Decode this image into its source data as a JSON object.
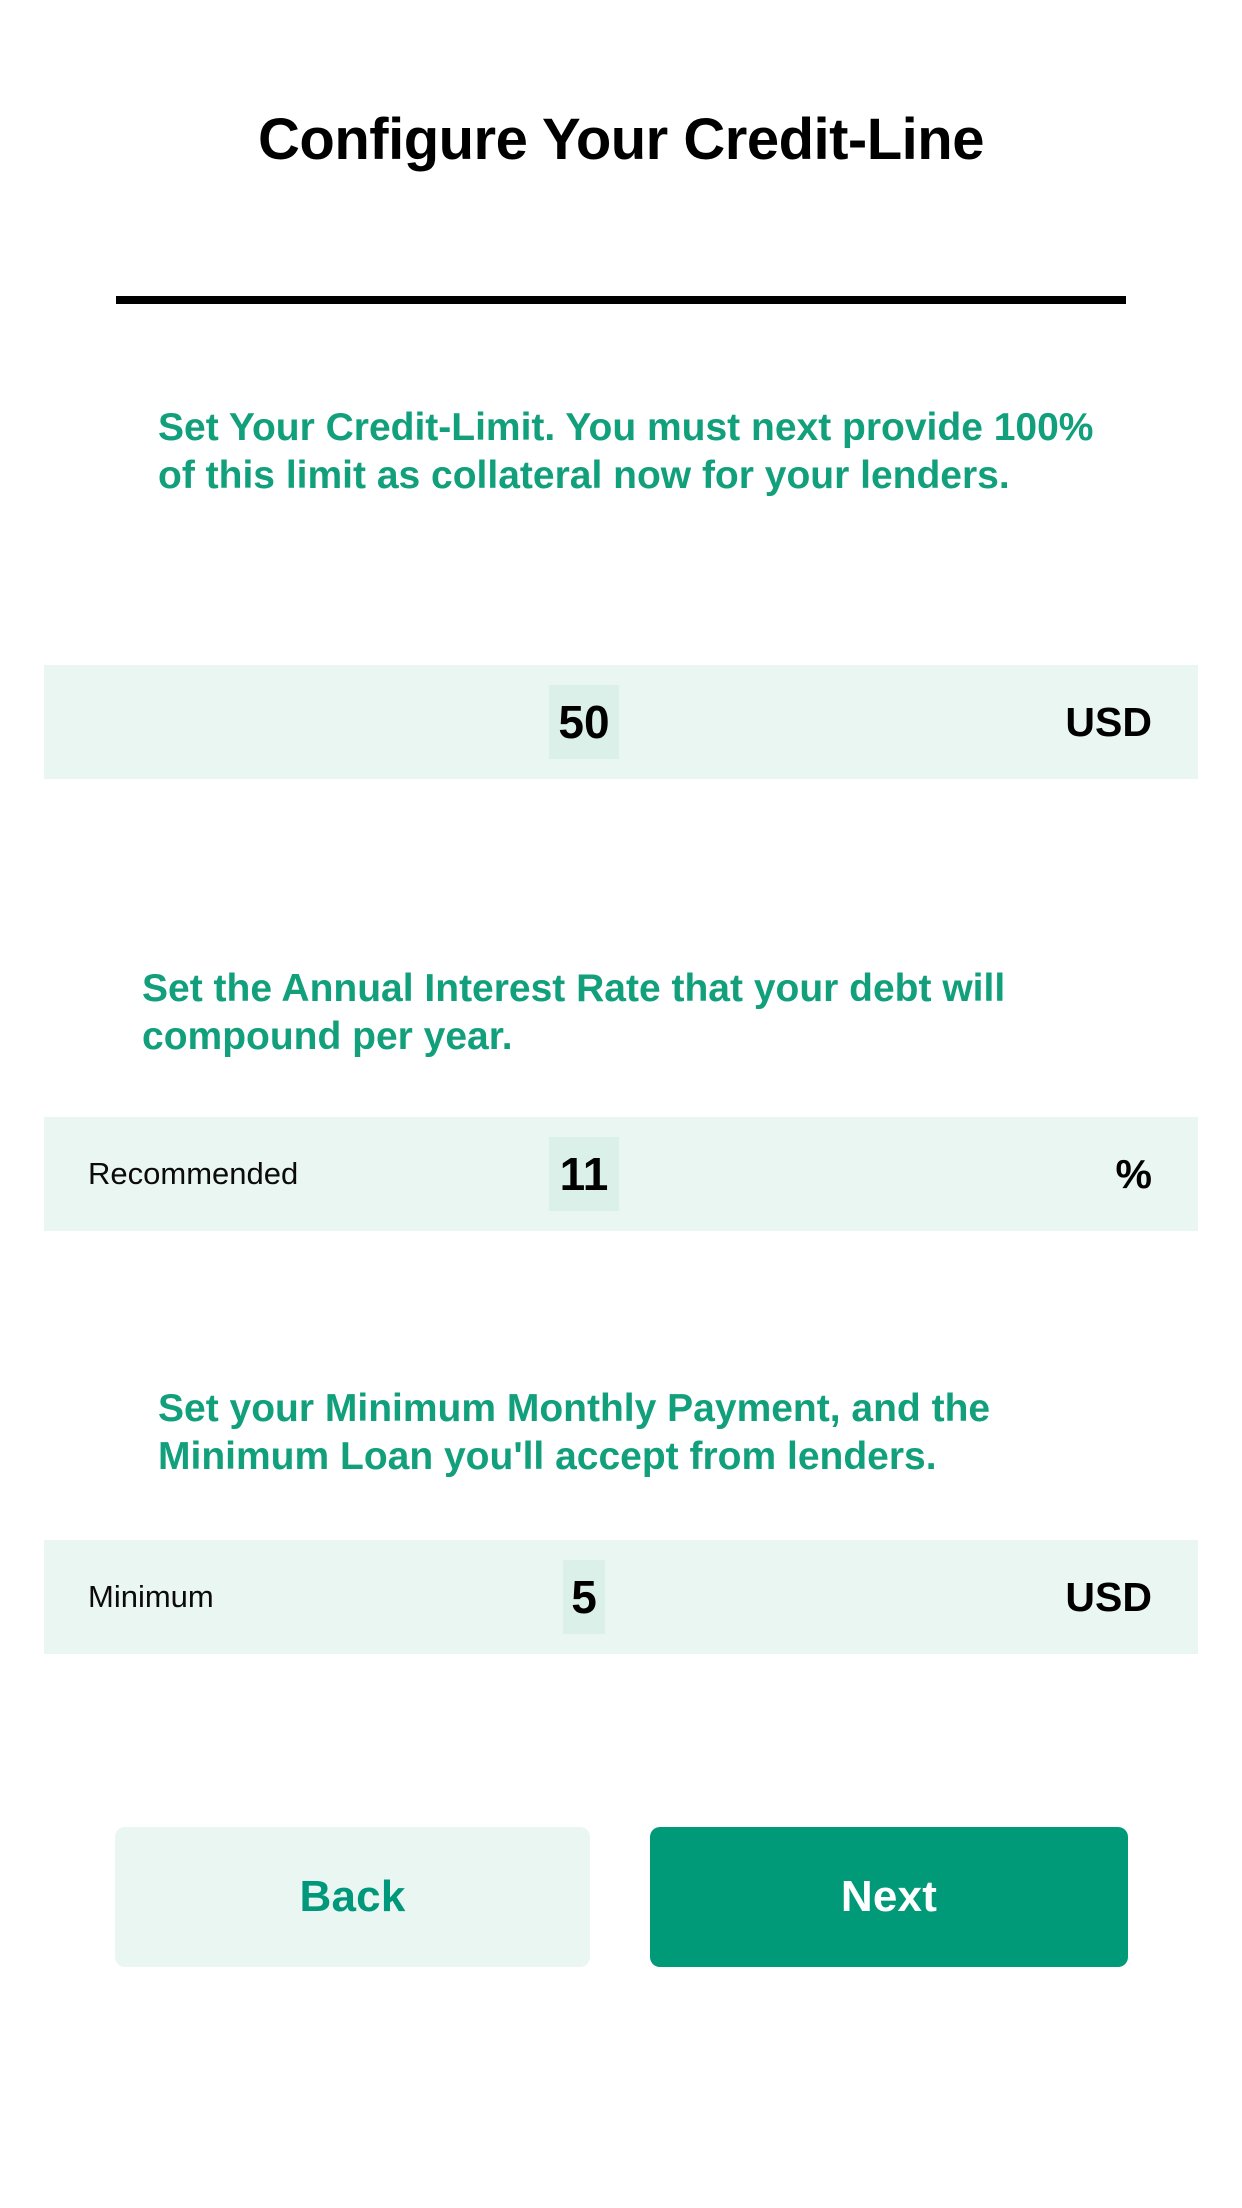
{
  "header": {
    "title": "Configure Your Credit-Line"
  },
  "colors": {
    "accent_green": "#009a79",
    "text_green": "#11a07b",
    "row_background": "#e9f6f1",
    "input_background": "#dcf0ea",
    "page_background": "#ffffff",
    "rule": "#000000"
  },
  "sections": [
    {
      "description": "Set Your Credit-Limit. You must next provide 100% of this limit as collateral now for your lenders.",
      "field": {
        "label": "",
        "value": "50",
        "placeholder": "0",
        "unit": "USD"
      }
    },
    {
      "description": "Set the Annual Interest Rate that your debt will compound per year.",
      "field": {
        "label": "Recommended",
        "value": "11",
        "placeholder": "0",
        "unit": "%"
      }
    },
    {
      "description": "Set your Minimum Monthly Payment, and the Minimum Loan you'll accept from lenders.",
      "field": {
        "label": "Minimum",
        "value": "5",
        "placeholder": "0",
        "unit": "USD"
      }
    }
  ],
  "footer": {
    "back_label": "Back",
    "next_label": "Next"
  }
}
